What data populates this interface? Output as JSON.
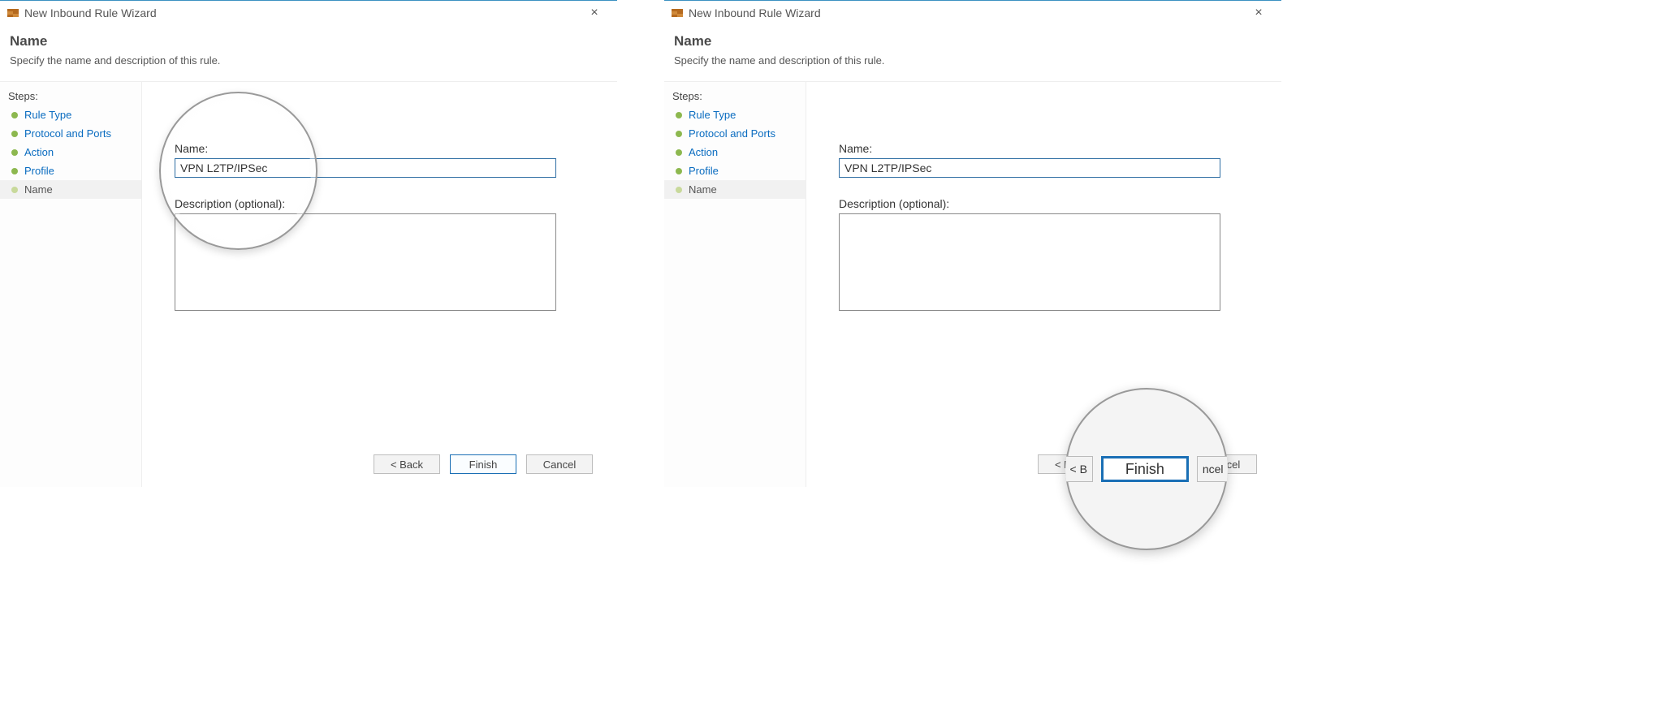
{
  "window": {
    "title": "New Inbound Rule Wizard"
  },
  "header": {
    "title": "Name",
    "subtitle": "Specify the name and description of this rule."
  },
  "sidebar": {
    "steps_label": "Steps:",
    "steps": [
      {
        "label": "Rule Type"
      },
      {
        "label": "Protocol and Ports"
      },
      {
        "label": "Action"
      },
      {
        "label": "Profile"
      },
      {
        "label": "Name"
      }
    ]
  },
  "form": {
    "name_label": "Name:",
    "name_value": "VPN L2TP/IPSec",
    "desc_label": "Description (optional):",
    "desc_value": ""
  },
  "buttons": {
    "back": "< Back",
    "finish": "Finish",
    "cancel": "Cancel",
    "back_frag": "< B",
    "cancel_frag": "ncel"
  }
}
